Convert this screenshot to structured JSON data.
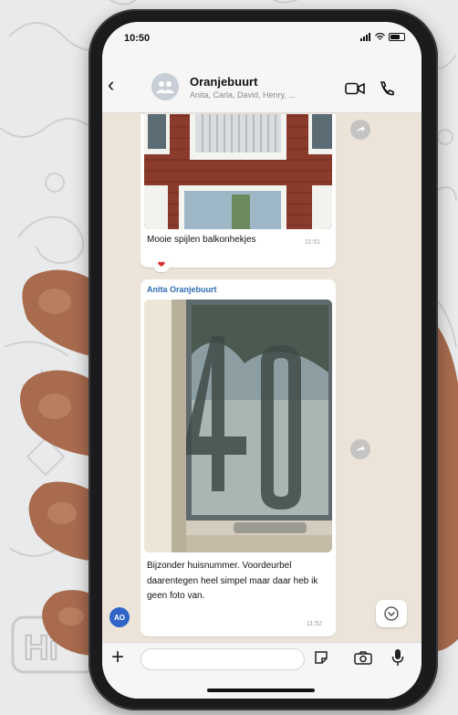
{
  "status": {
    "time": "10:50"
  },
  "header": {
    "group_name": "Oranjebuurt",
    "members": "Anita, Carla, David, Henry, ..."
  },
  "messages": [
    {
      "type": "image",
      "caption": "Mooie spijlen balkonhekjes",
      "time": "11:51",
      "reaction": "❤"
    },
    {
      "type": "image",
      "sender": "Anita Oranjebuurt",
      "caption": "Bijzonder huisnummer. Voordeurbel daarentegen heel simpel maar daar heb ik geen foto van.",
      "time": "11:52",
      "sender_initials": "AO"
    }
  ],
  "input": {
    "placeholder": ""
  },
  "colors": {
    "accent_blue": "#2f63c8",
    "sender_name": "#2d6cb5",
    "chat_bg": "#ece4d9"
  }
}
